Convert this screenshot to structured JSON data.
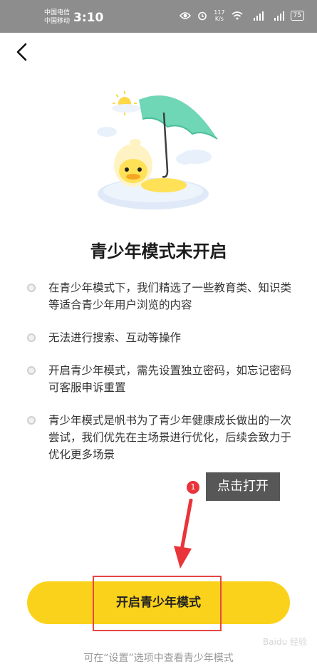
{
  "status_bar": {
    "carrier_1": "中国电信",
    "carrier_2": "中国移动",
    "time": "3:10",
    "speed_value": "117",
    "speed_unit": "K/s",
    "battery": "75"
  },
  "header": {
    "back_icon": "chevron-left-icon"
  },
  "page": {
    "title": "青少年模式未开启",
    "rules": [
      {
        "text": "在青少年模式下，我们精选了一些教育类、知识类等适合青少年用户浏览的内容"
      },
      {
        "text": "无法进行搜索、互动等操作"
      },
      {
        "text": "开启青少年模式，需先设置独立密码，如忘记密码可客服申诉重置"
      },
      {
        "text": "青少年模式是帆书为了青少年健康成长做出的一次尝试，我们优先在主场景进行优化，后续会致力于优化更多场景"
      }
    ],
    "enable_button_label": "开启青少年模式",
    "footer_hint": "可在“设置”选项中查看青少年模式"
  },
  "annotation": {
    "badge_number": "1",
    "label": "点击打开"
  },
  "watermark": "Baidu 经验",
  "colors": {
    "accent": "#fbd21b",
    "annotation_red": "#e84545",
    "status_bar": "#8d8d8d"
  }
}
